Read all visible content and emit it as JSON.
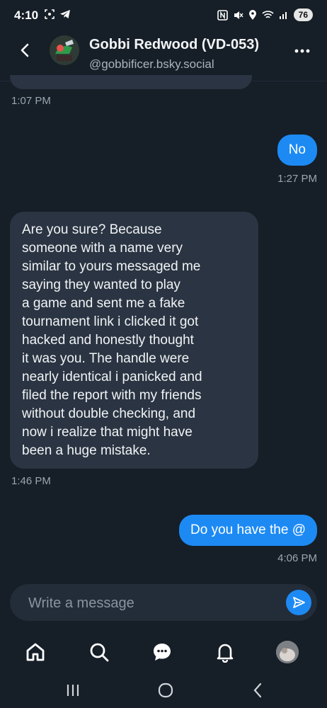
{
  "status_bar": {
    "time": "4:10",
    "battery": "76"
  },
  "header": {
    "contact_name": "Gobbi Redwood (VD-053)",
    "contact_handle": "@gobbificer.bsky.social"
  },
  "messages": [
    {
      "direction": "in",
      "text": "",
      "time": "1:07 PM",
      "partial": true
    },
    {
      "direction": "out",
      "text": "No",
      "time": "1:27 PM"
    },
    {
      "direction": "in",
      "lines": [
        "Are you sure? Because",
        "someone with a name very",
        "similar to yours messaged me",
        "saying they wanted to play",
        "a game and sent me a fake",
        "tournament link i clicked it got",
        "hacked and honestly thought",
        "it was you. The handle were",
        "nearly identical i panicked and",
        "filed the report with my friends",
        "without double checking, and",
        "now i realize that might have",
        "been a huge mistake."
      ],
      "time": "1:46 PM"
    },
    {
      "direction": "out",
      "text": "Do you have the @",
      "time": "4:06 PM"
    }
  ],
  "composer": {
    "placeholder": "Write a message"
  },
  "tabbar": [
    "home-icon",
    "search-icon",
    "chat-icon",
    "bell-icon",
    "profile-avatar"
  ],
  "colors": {
    "background": "#161e27",
    "bubble_in": "#2a3442",
    "bubble_out": "#1d8af4",
    "muted_text": "#9aa6b2"
  }
}
